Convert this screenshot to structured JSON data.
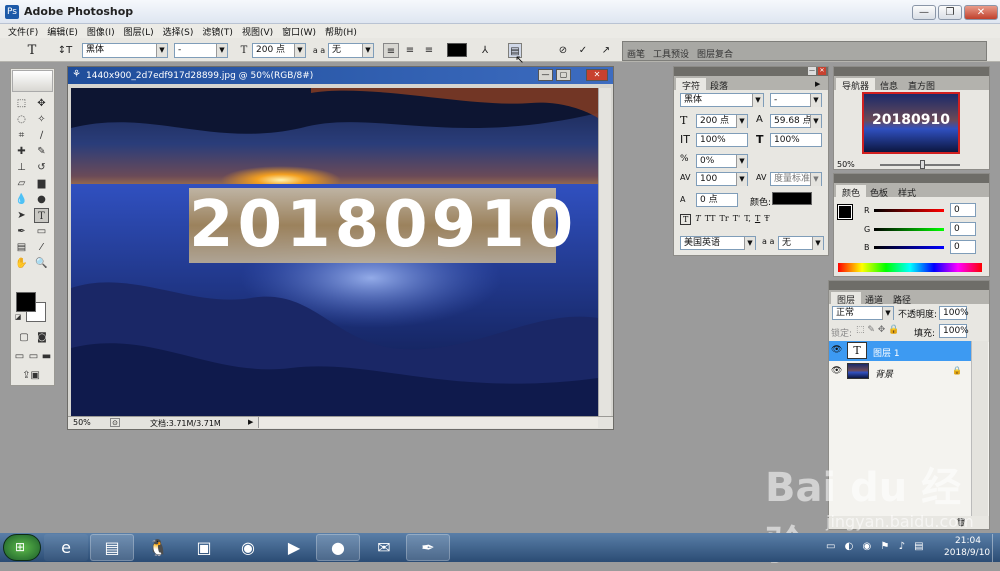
{
  "app": {
    "title": "Adobe Photoshop",
    "icon": "Ps"
  },
  "window_buttons": {
    "minimize": "—",
    "restore": "❐",
    "close": "✕"
  },
  "menu": [
    "文件(F)",
    "编辑(E)",
    "图像(I)",
    "图层(L)",
    "选择(S)",
    "滤镜(T)",
    "视图(V)",
    "窗口(W)",
    "帮助(H)"
  ],
  "options": {
    "tool_glyph": "T",
    "orient_glyph": "↕T",
    "font_family": "黑体",
    "font_style": "-",
    "size_glyph": "T",
    "font_size": "200 点",
    "aa_label": "a a",
    "aa_value": "无",
    "color": "#000000",
    "wells": [
      "画笔",
      "工具预设",
      "图层复合"
    ]
  },
  "document": {
    "title": "1440x900_2d7edf917d28899.jpg @ 50%(RGB/8#)",
    "text_layer": "20180910",
    "zoom": "50%",
    "status": "文档:3.71M/3.71M"
  },
  "character_panel": {
    "tabs": [
      "字符",
      "段落"
    ],
    "font_family": "黑体",
    "font_style": "-",
    "size": "200 点",
    "leading": "59.68 点",
    "vscale": "100%",
    "hscale": "100%",
    "tracking": "0%",
    "kerning": "100",
    "kern_mode": "度量标准",
    "baseline": "0 点",
    "color_label": "颜色:",
    "style_buttons": [
      "T",
      "T",
      "TT",
      "Tr",
      "T'",
      "T,",
      "T",
      "Ŧ"
    ],
    "language": "美国英语",
    "aa_label": "a a",
    "aa_value": "无"
  },
  "navigator_panel": {
    "tabs": [
      "导航器",
      "信息",
      "直方图"
    ],
    "zoom": "50%",
    "preview_text": "20180910"
  },
  "color_panel": {
    "tabs": [
      "颜色",
      "色板",
      "样式"
    ],
    "r_label": "R",
    "g_label": "G",
    "b_label": "B",
    "r": "0",
    "g": "0",
    "b": "0"
  },
  "layers_panel": {
    "tabs": [
      "图层",
      "通道",
      "路径"
    ],
    "blend": "正常",
    "opacity_label": "不透明度:",
    "opacity": "100%",
    "lock_label": "锁定:",
    "fill_label": "填充:",
    "fill": "100%",
    "layers": [
      {
        "name": "图层 1",
        "thumb": "T",
        "selected": true
      },
      {
        "name": "背景",
        "thumb": "",
        "selected": false
      }
    ]
  },
  "watermark": {
    "text": "Bai du 经验",
    "url": "jingyan.baidu.com"
  },
  "taskbar": {
    "time": "21:04",
    "date": "2018/9/10",
    "apps": [
      "e",
      "▤",
      "🐧",
      "▣",
      "◉",
      "▶",
      "●",
      "✉",
      "✒"
    ]
  }
}
